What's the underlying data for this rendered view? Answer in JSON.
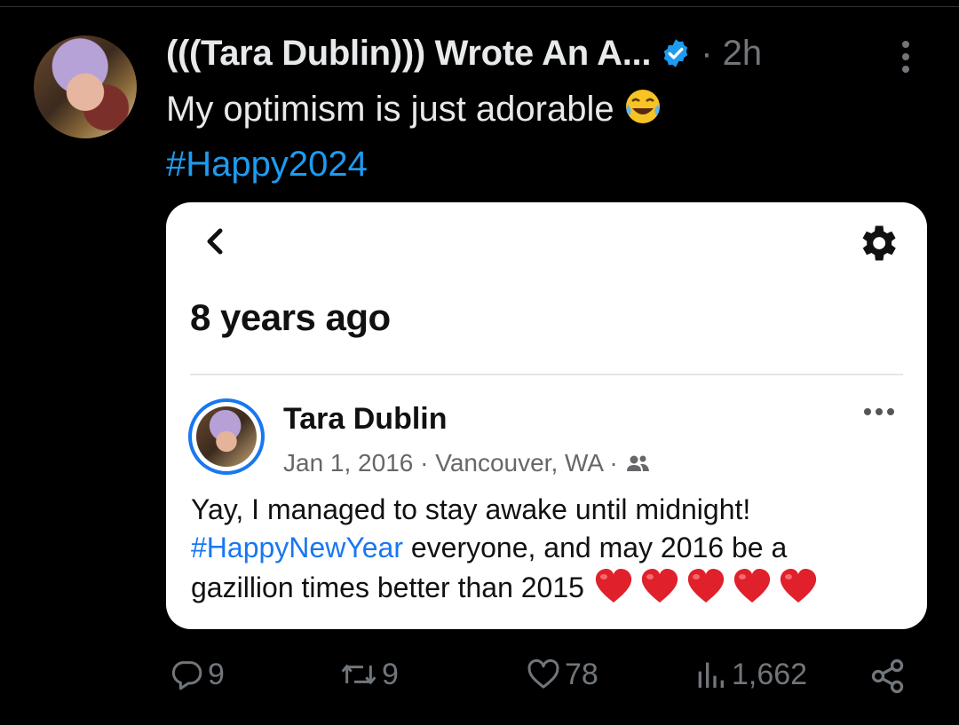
{
  "tweet": {
    "author_name": "(((Tara Dublin))) Wrote An A...",
    "time": "· 2h",
    "text_line1": "My optimism is just adorable",
    "hashtag": "#Happy2024"
  },
  "card": {
    "title": "8 years ago",
    "post": {
      "author": "Tara Dublin",
      "meta": "Jan 1, 2016 · Vancouver, WA ·",
      "line1": "Yay, I managed to stay awake until midnight!",
      "line2_link": "#HappyNewYear",
      "line2_rest": " everyone, and may 2016 be a",
      "line3": "gazillion times better than 2015"
    }
  },
  "actions": {
    "replies": "9",
    "reposts": "9",
    "likes": "78",
    "views": "1,662"
  },
  "icons": {
    "verified": "verified-badge-icon",
    "more": "more-vertical-icon",
    "emoji": "face-with-tears-of-joy-emoji",
    "back": "chevron-left-icon",
    "settings": "gear-icon",
    "audience": "friends-icon",
    "heart": "red-heart-emoji",
    "reply": "reply-icon",
    "repost": "repost-icon",
    "like": "heart-icon",
    "views": "views-bar-chart-icon",
    "share": "share-icon"
  },
  "colors": {
    "background": "#000000",
    "text": "#e7e9ea",
    "muted": "#71767b",
    "twitter_blue": "#1d9bf0",
    "facebook_blue": "#1877f2"
  }
}
